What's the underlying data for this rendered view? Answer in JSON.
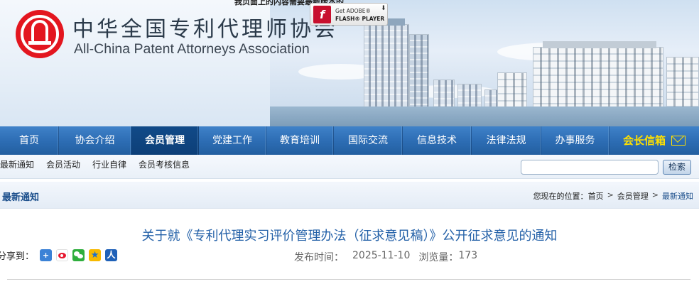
{
  "header": {
    "title_cn": "中华全国专利代理师协会",
    "title_en": "All-China Patent Attorneys Association",
    "top_notice": "我页面上的内容需要最新版本的",
    "flash_badge": {
      "line1": "Get ADOBE®",
      "line2": "FLASH® PLAYER",
      "icon": "flash-icon"
    },
    "colors": {
      "logo": "#e3161f"
    }
  },
  "main_nav": {
    "items": [
      {
        "label": "首页"
      },
      {
        "label": "协会介绍"
      },
      {
        "label": "会员管理",
        "active": true
      },
      {
        "label": "党建工作"
      },
      {
        "label": "教育培训"
      },
      {
        "label": "国际交流"
      },
      {
        "label": "信息技术"
      },
      {
        "label": "法律法规"
      },
      {
        "label": "办事服务"
      },
      {
        "label": "会长信箱",
        "icon": "mail-icon"
      }
    ],
    "colors": {
      "bar": "#2c6cb3",
      "active": "#114a88",
      "mailbox": "#ffe000"
    }
  },
  "sub_nav": {
    "items": [
      {
        "label": "最新通知"
      },
      {
        "label": "会员活动"
      },
      {
        "label": "行业自律"
      },
      {
        "label": "会员考核信息"
      }
    ],
    "search": {
      "value": "",
      "placeholder": "",
      "button_label": "检索"
    }
  },
  "section": {
    "title": "最新通知",
    "breadcrumb": {
      "prefix": "您现在的位置：",
      "items": [
        "首页",
        "会员管理",
        "最新通知"
      ],
      "separator": ">"
    }
  },
  "article": {
    "title": "关于就《专利代理实习评价管理办法（征求意见稿）》公开征求意见的通知",
    "share_label": "分享到：",
    "share_icons": [
      "plus-icon",
      "weibo-icon",
      "wechat-icon",
      "qzone-icon",
      "renren-icon"
    ],
    "publish_label": "发布时间：",
    "publish_date": "2025-11-10",
    "views_label": "浏览量：",
    "views": "173"
  }
}
